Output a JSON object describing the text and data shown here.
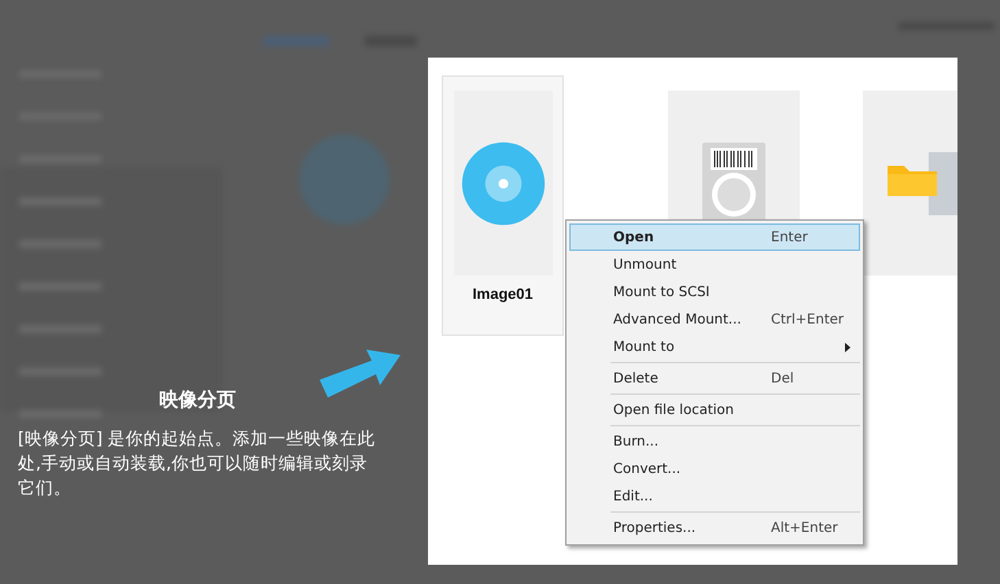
{
  "tip": {
    "title": "映像分页",
    "text": "[映像分页] 是你的起始点。添加一些映像在此处,手动或自动装载,你也可以随时编辑或刻录它们。"
  },
  "cards": [
    {
      "kind": "disc",
      "label": "Image01",
      "selected": true
    },
    {
      "kind": "drive",
      "selected": false
    },
    {
      "kind": "archive",
      "selected": false
    }
  ],
  "context_menu": {
    "items": [
      {
        "kind": "item",
        "label": "Open",
        "shortcut": "Enter",
        "selected": true
      },
      {
        "kind": "item",
        "label": "Unmount",
        "selected": false
      },
      {
        "kind": "item",
        "label": "Mount to SCSI",
        "selected": false
      },
      {
        "kind": "item",
        "label": "Advanced Mount...",
        "shortcut": "Ctrl+Enter",
        "selected": false
      },
      {
        "kind": "item",
        "label": "Mount to",
        "selected": false,
        "submenu": true
      },
      {
        "kind": "separator"
      },
      {
        "kind": "item",
        "label": "Delete",
        "shortcut": "Del",
        "selected": false
      },
      {
        "kind": "separator"
      },
      {
        "kind": "item",
        "label": "Open file location",
        "selected": false
      },
      {
        "kind": "separator"
      },
      {
        "kind": "item",
        "label": "Burn...",
        "selected": false
      },
      {
        "kind": "item",
        "label": "Convert...",
        "selected": false
      },
      {
        "kind": "item",
        "label": "Edit...",
        "selected": false
      },
      {
        "kind": "separator"
      },
      {
        "kind": "item",
        "label": "Properties...",
        "shortcut": "Alt+Enter",
        "selected": false
      }
    ]
  }
}
